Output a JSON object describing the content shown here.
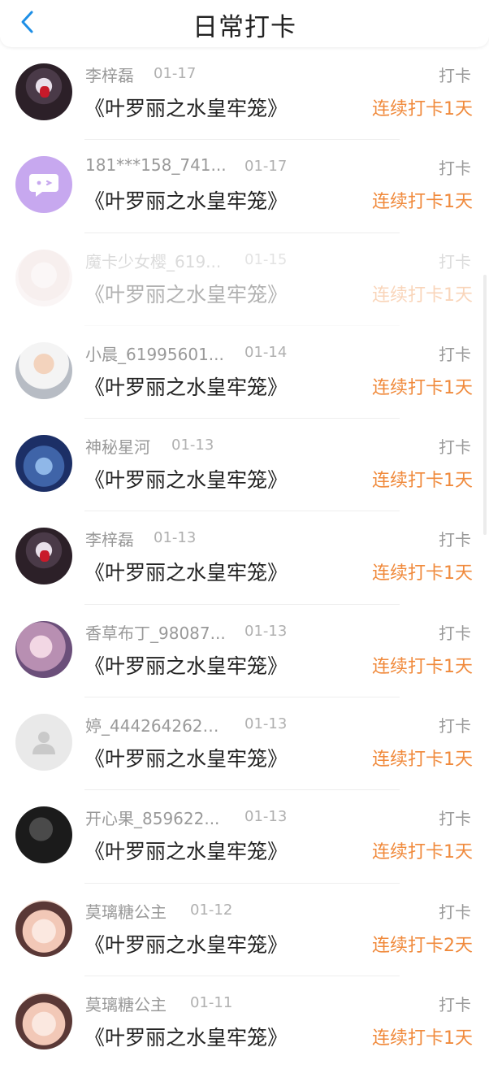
{
  "header": {
    "title": "日常打卡",
    "back_icon": "chevron-left-icon",
    "accent": "#1e8fe6"
  },
  "colors": {
    "streak": "#f08a3c",
    "muted": "#999999",
    "text": "#222222"
  },
  "items": [
    {
      "name": "李梓磊",
      "date": "01-17",
      "book": "《叶罗丽之水皇牢笼》",
      "action": "打卡",
      "streak": "连续打卡1天",
      "avatar": "ink"
    },
    {
      "name": "181***158_741...",
      "date": "01-17",
      "book": "《叶罗丽之水皇牢笼》",
      "action": "打卡",
      "streak": "连续打卡1天",
      "avatar": "purple"
    },
    {
      "name": "魔卡少女樱_619...",
      "date": "01-15",
      "book": "《叶罗丽之水皇牢笼》",
      "action": "打卡",
      "streak": "连续打卡1天",
      "avatar": "lace"
    },
    {
      "name": "小晨_61995601...",
      "date": "01-14",
      "book": "《叶罗丽之水皇牢笼》",
      "action": "打卡",
      "streak": "连续打卡1天",
      "avatar": "kid"
    },
    {
      "name": "神秘星河",
      "date": "01-13",
      "book": "《叶罗丽之水皇牢笼》",
      "action": "打卡",
      "streak": "连续打卡1天",
      "avatar": "galaxy"
    },
    {
      "name": "李梓磊",
      "date": "01-13",
      "book": "《叶罗丽之水皇牢笼》",
      "action": "打卡",
      "streak": "连续打卡1天",
      "avatar": "ink"
    },
    {
      "name": "香草布丁_98087...",
      "date": "01-13",
      "book": "《叶罗丽之水皇牢笼》",
      "action": "打卡",
      "streak": "连续打卡1天",
      "avatar": "doll"
    },
    {
      "name": "婷_4442642623...",
      "date": "01-13",
      "book": "《叶罗丽之水皇牢笼》",
      "action": "打卡",
      "streak": "连续打卡1天",
      "avatar": "default"
    },
    {
      "name": "开心果_859622...",
      "date": "01-13",
      "book": "《叶罗丽之水皇牢笼》",
      "action": "打卡",
      "streak": "连续打卡1天",
      "avatar": "dark"
    },
    {
      "name": "莫璃糖公主",
      "date": "01-12",
      "book": "《叶罗丽之水皇牢笼》",
      "action": "打卡",
      "streak": "连续打卡2天",
      "avatar": "anime"
    },
    {
      "name": "莫璃糖公主",
      "date": "01-11",
      "book": "《叶罗丽之水皇牢笼》",
      "action": "打卡",
      "streak": "连续打卡1天",
      "avatar": "anime"
    }
  ]
}
